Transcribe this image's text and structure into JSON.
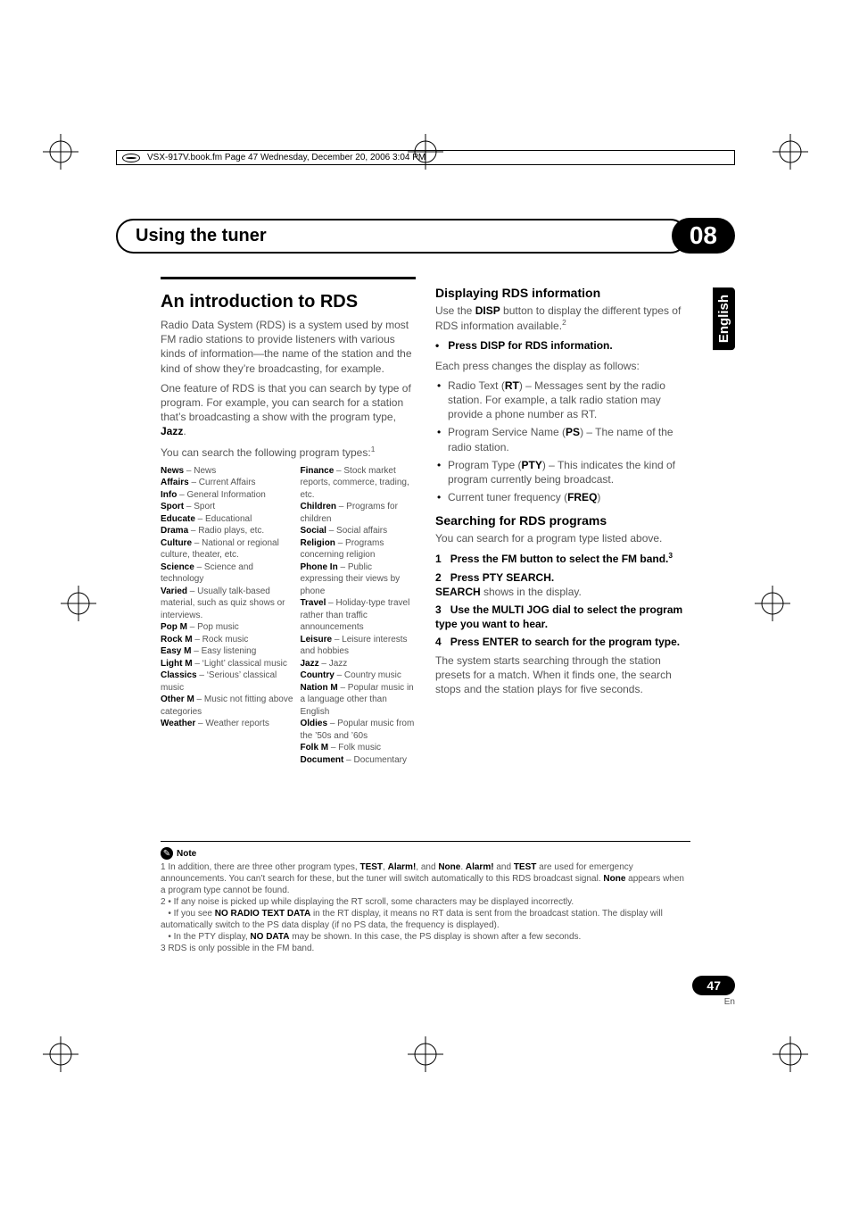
{
  "header": {
    "stamp": "VSX-917V.book.fm  Page 47  Wednesday, December 20, 2006  3:04 PM"
  },
  "chapter": {
    "title": "Using the tuner",
    "number": "08"
  },
  "language_tab": "English",
  "left": {
    "rds_heading": "An introduction to RDS",
    "rds_p1": "Radio Data System (RDS) is a system used by most FM radio stations to provide listeners with various kinds of information—the name of the station and the kind of show they’re broadcasting, for example.",
    "rds_p2_a": "One feature of RDS is that you can search by type of program. For example, you can search for a station that’s broadcasting a show with the program type, ",
    "rds_p2_b": "Jazz",
    "rds_p2_c": ".",
    "rds_p3": "You can search the following program types:",
    "sup1": "1",
    "types_col1": [
      {
        "b": "News",
        "t": " – News"
      },
      {
        "b": "Affairs",
        "t": " – Current Affairs"
      },
      {
        "b": "Info",
        "t": " – General Information"
      },
      {
        "b": "Sport",
        "t": " – Sport"
      },
      {
        "b": "Educate",
        "t": " – Educational"
      },
      {
        "b": "Drama",
        "t": " – Radio plays, etc."
      },
      {
        "b": "Culture",
        "t": " – National or regional culture, theater, etc."
      },
      {
        "b": "Science",
        "t": " – Science and technology"
      },
      {
        "b": "Varied",
        "t": " – Usually talk-based material, such as quiz shows or interviews."
      },
      {
        "b": "Pop M",
        "t": " – Pop music"
      },
      {
        "b": "Rock M",
        "t": " – Rock music"
      },
      {
        "b": "Easy M",
        "t": " – Easy listening"
      },
      {
        "b": "Light M",
        "t": " – ‘Light’ classical music"
      },
      {
        "b": "Classics",
        "t": " – ‘Serious’ classical music"
      },
      {
        "b": "Other M",
        "t": " – Music not fitting above categories"
      },
      {
        "b": "Weather",
        "t": " – Weather reports"
      }
    ],
    "types_col2": [
      {
        "b": "Finance",
        "t": " – Stock market reports, commerce, trading, etc."
      },
      {
        "b": "Children",
        "t": " – Programs for children"
      },
      {
        "b": "Social",
        "t": " – Social affairs"
      },
      {
        "b": "Religion",
        "t": " – Programs concerning religion"
      },
      {
        "b": "Phone In",
        "t": " – Public expressing their views by phone"
      },
      {
        "b": "Travel",
        "t": " – Holiday-type travel rather than traffic announcements"
      },
      {
        "b": "Leisure",
        "t": " – Leisure interests and hobbies"
      },
      {
        "b": "Jazz",
        "t": " – Jazz"
      },
      {
        "b": "Country",
        "t": " – Country music"
      },
      {
        "b": "Nation M",
        "t": " – Popular music in a language other than English"
      },
      {
        "b": "Oldies",
        "t": " – Popular music from the ’50s and ’60s"
      },
      {
        "b": "Folk M",
        "t": " – Folk music"
      },
      {
        "b": "Document",
        "t": " – Documentary"
      }
    ]
  },
  "right": {
    "disp_heading": "Displaying RDS information",
    "disp_p_a": "Use the ",
    "disp_p_b": "DISP",
    "disp_p_c": " button to display the different types of RDS information available.",
    "sup2": "2",
    "press_disp": "Press DISP for RDS information.",
    "press_disp_sub": "Each press changes the display as follows:",
    "bullets": [
      {
        "pre": "Radio Text (",
        "b": "RT",
        "post": ") – Messages sent by the radio station. For example, a talk radio station may provide a phone number as RT."
      },
      {
        "pre": "Program Service Name (",
        "b": "PS",
        "post": ") – The name of the radio station."
      },
      {
        "pre": "Program Type (",
        "b": "PTY",
        "post": ") – This indicates the kind of program currently being broadcast."
      },
      {
        "pre": "Current tuner frequency (",
        "b": "FREQ",
        "post": ")"
      }
    ],
    "search_heading": "Searching for RDS programs",
    "search_p": "You can search for a program type listed above.",
    "steps": {
      "s1_n": "1",
      "s1_b": "Press the FM button to select the FM band.",
      "s1_sup": "3",
      "s2_n": "2",
      "s2_b": "Press PTY SEARCH.",
      "s2_post_b": "SEARCH",
      "s2_post": " shows in the display.",
      "s3_n": "3",
      "s3_b": "Use the MULTI JOG dial to select the program type you want to hear.",
      "s4_n": "4",
      "s4_b": "Press ENTER to search for the program type.",
      "s4_post": "The system starts searching through the station presets for a match. When it finds one, the search stops and the station plays for five seconds."
    }
  },
  "notes": {
    "label": "Note",
    "n1_a": "1 In addition, there are three other program types, ",
    "n1_b1": "TEST",
    "n1_s1": ", ",
    "n1_b2": "Alarm!",
    "n1_s2": ", and ",
    "n1_b3": "None",
    "n1_s3": ". ",
    "n1_b4": "Alarm!",
    "n1_s4": " and ",
    "n1_b5": "TEST",
    "n1_s5": " are used for emergency announcements. You can’t search for these, but the tuner will switch automatically to this RDS broadcast signal. ",
    "n1_b6": "None",
    "n1_s6": " appears when a program type cannot be found.",
    "n2": "2 • If any noise is picked up while displaying the RT scroll, some characters may be displayed incorrectly.",
    "n2b_pre": "• If you see ",
    "n2b_b": "NO RADIO TEXT DATA",
    "n2b_post": " in the RT display, it means no RT data is sent from the broadcast station. The display will automatically switch to the PS data display (if no PS data, the frequency is displayed).",
    "n2c_pre": "• In the PTY display, ",
    "n2c_b": "NO DATA",
    "n2c_post": " may be shown. In this case, the PS display is shown after a few seconds.",
    "n3": "3 RDS is only possible in the FM band."
  },
  "pagenum": {
    "num": "47",
    "lang": "En"
  }
}
